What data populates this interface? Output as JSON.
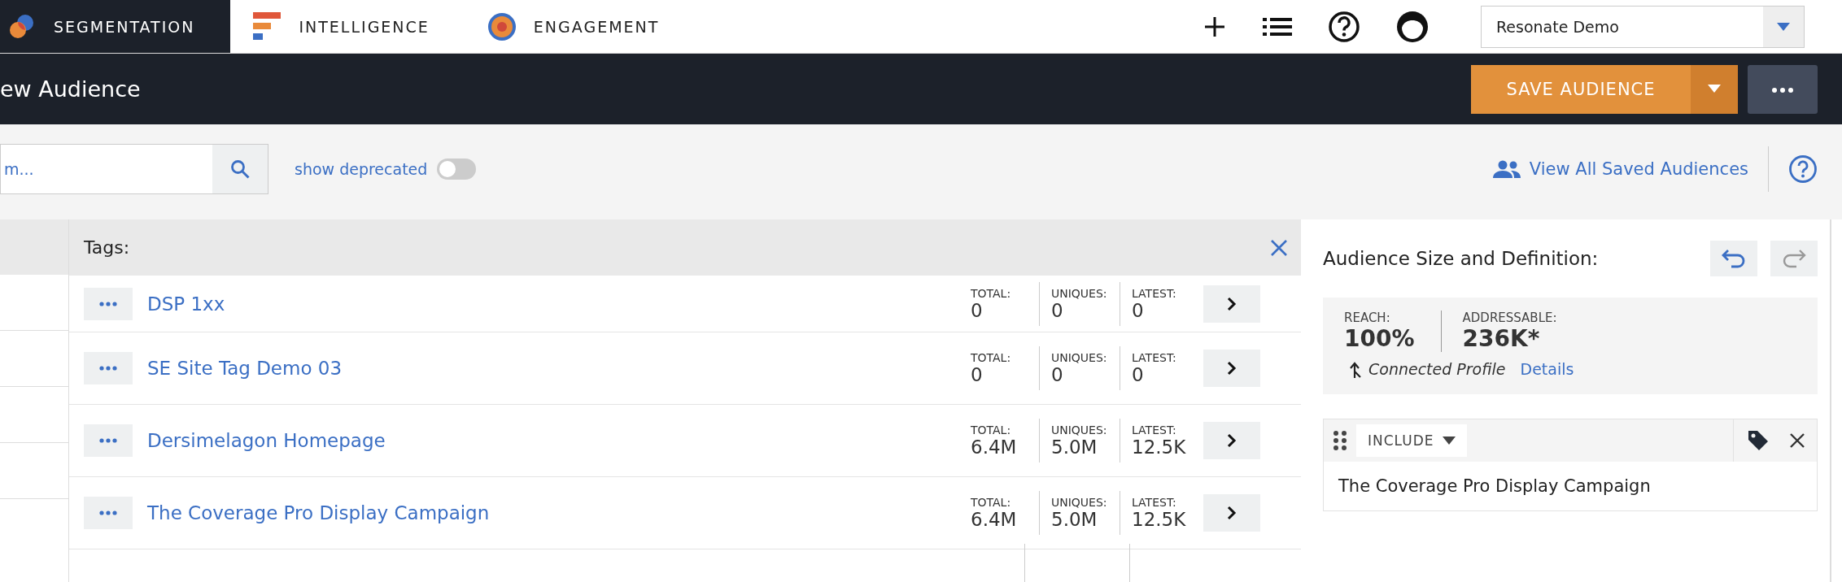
{
  "nav": {
    "tabs": [
      {
        "label": "SEGMENTATION",
        "selected": true,
        "kind": "segmentation"
      },
      {
        "label": "INTELLIGENCE",
        "selected": false,
        "kind": "intelligence"
      },
      {
        "label": "ENGAGEMENT",
        "selected": false,
        "kind": "engagement"
      }
    ],
    "account_select": "Resonate Demo"
  },
  "header": {
    "title": "ew Audience",
    "save_button": "SAVE AUDIENCE"
  },
  "toolbar": {
    "search": {
      "placeholder": "m..."
    },
    "toggle": {
      "label": "show deprecated",
      "on": false
    },
    "saved_link": "View All Saved Audiences"
  },
  "tags_panel": {
    "title": "Tags:",
    "rows": [
      {
        "name": "DSP 1xx",
        "stats": [
          {
            "label": "TOTAL:",
            "value": "0"
          },
          {
            "label": "UNIQUES:",
            "value": "0"
          },
          {
            "label": "LATEST:",
            "value": "0"
          }
        ]
      },
      {
        "name": "SE Site Tag Demo 03",
        "stats": [
          {
            "label": "TOTAL:",
            "value": "0"
          },
          {
            "label": "UNIQUES:",
            "value": "0"
          },
          {
            "label": "LATEST:",
            "value": "0"
          }
        ]
      },
      {
        "name": "Dersimelagon Homepage",
        "stats": [
          {
            "label": "TOTAL:",
            "value": "6.4M"
          },
          {
            "label": "UNIQUES:",
            "value": "5.0M"
          },
          {
            "label": "LATEST:",
            "value": "12.5K"
          }
        ]
      },
      {
        "name": "The Coverage Pro Display Campaign",
        "stats": [
          {
            "label": "TOTAL:",
            "value": "6.4M"
          },
          {
            "label": "UNIQUES:",
            "value": "5.0M"
          },
          {
            "label": "LATEST:",
            "value": "12.5K"
          }
        ]
      }
    ]
  },
  "definition": {
    "title": "Audience Size and Definition:",
    "undo_disabled": false,
    "redo_disabled": true,
    "stats": [
      {
        "label": "REACH:",
        "value": "100%"
      },
      {
        "label": "ADDRESSABLE:",
        "value": "236K*"
      }
    ],
    "profile": "Connected Profile",
    "details_link": "Details",
    "rule": {
      "mode": "INCLUDE",
      "item": "The Coverage Pro Display Campaign"
    }
  }
}
